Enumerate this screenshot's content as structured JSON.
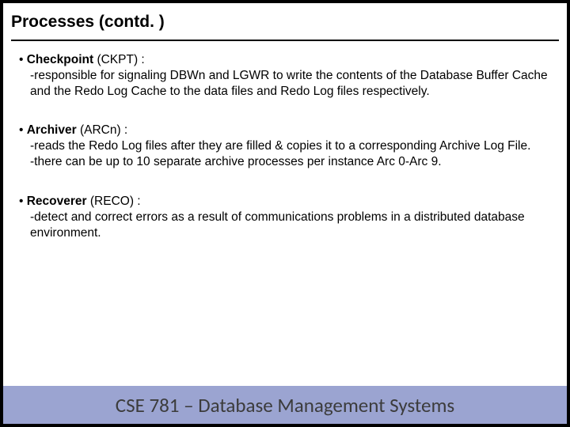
{
  "title": "Processes (contd. )",
  "items": [
    {
      "bold": "Checkpoint",
      "rest": " (CKPT) :",
      "details": [
        "-responsible for signaling DBWn and LGWR to write the contents of the Database Buffer Cache and the Redo Log Cache to the data files and Redo Log files respectively."
      ]
    },
    {
      "bold": "Archiver",
      "rest": " (ARCn) :",
      "details": [
        "-reads the Redo Log files after they are filled & copies it to a corresponding Archive Log File.",
        "-there can be up to 10 separate archive processes per instance Arc 0-Arc 9."
      ]
    },
    {
      "bold": "Recoverer",
      "rest": " (RECO) :",
      "details": [
        "-detect and correct errors as a result of communications problems in a distributed database environment."
      ]
    }
  ],
  "footer": "CSE 781 – Database Management Systems"
}
